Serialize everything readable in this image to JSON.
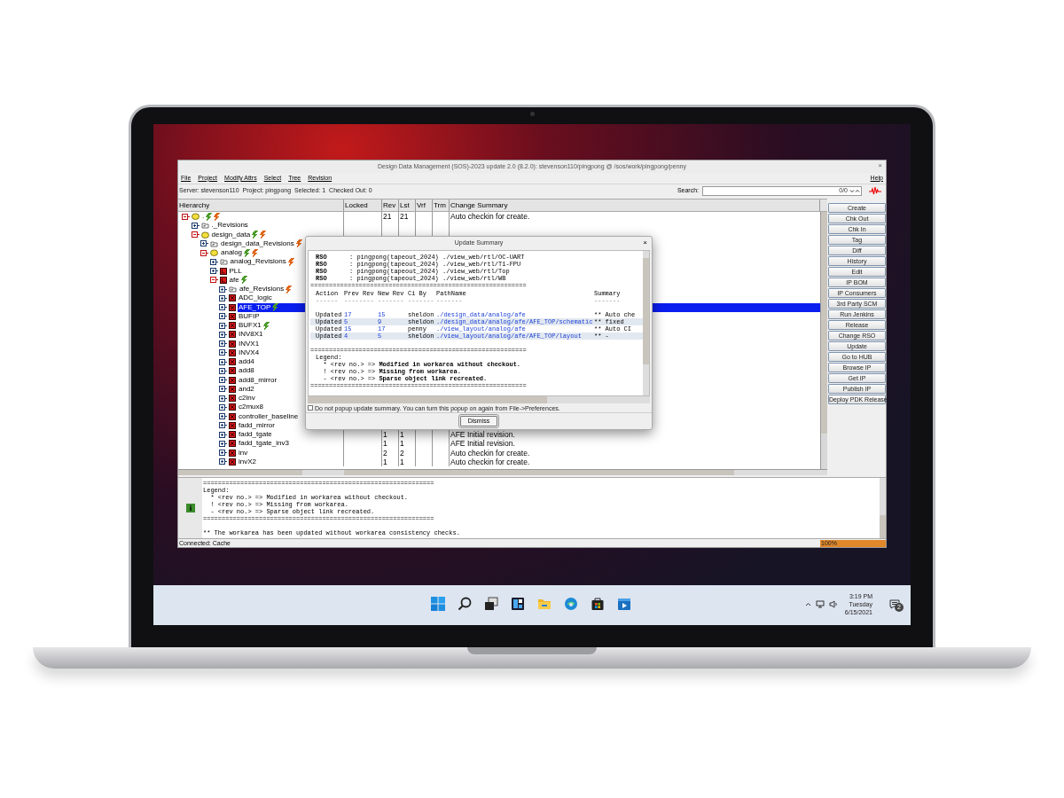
{
  "window": {
    "title": "Design Data Management (SOS)-2023 update 2.0 (8.2.0): stevenson110/pingpong @ /sos/work/pingpong/penny",
    "close": "×"
  },
  "menu": [
    "File",
    "Project",
    "Modify Attrs",
    "Select",
    "Tree",
    "Revision"
  ],
  "help_menu": "Help",
  "info_bar": [
    "Server: stevenson110",
    "Project: pingpong",
    "Selected: 1",
    "Checked Out: 0"
  ],
  "search": {
    "label": "Search:",
    "count": "0/0"
  },
  "main": {
    "columns": [
      "Hierarchy",
      "Locked",
      "Rev",
      "Lst",
      "Vrf",
      "Trm",
      "Change Summary"
    ],
    "tree": [
      {
        "name": ".",
        "kind": "folder",
        "expanded": true,
        "selected": false,
        "badges": [
          {
            "color": "#4a9a2a"
          },
          {
            "color": "#e0661a"
          }
        ],
        "rev": "21",
        "lst": "21",
        "summary": "Auto checkin for create.",
        "children": [
          {
            "name": "._Revisions",
            "kind": "revisions",
            "expanded": false,
            "selected": false
          },
          {
            "name": "design_data",
            "kind": "folder",
            "expanded": true,
            "selected": false,
            "badges": [
              {
                "color": "#4a9a2a"
              },
              {
                "color": "#e0661a"
              }
            ],
            "children": [
              {
                "name": "design_data_Revisions",
                "kind": "revisions",
                "expanded": false,
                "selected": false,
                "badges": [
                  {
                    "color": "#e0661a"
                  }
                ]
              },
              {
                "name": "analog",
                "kind": "folder",
                "expanded": true,
                "selected": false,
                "badges": [
                  {
                    "color": "#4a9a2a"
                  },
                  {
                    "color": "#e0661a"
                  }
                ],
                "children": [
                  {
                    "name": "analog_Revisions",
                    "kind": "revisions",
                    "expanded": false,
                    "selected": false,
                    "badges": [
                      {
                        "color": "#e0661a"
                      }
                    ]
                  },
                  {
                    "name": "PLL",
                    "kind": "library",
                    "expanded": false,
                    "selected": false
                  },
                  {
                    "name": "afe",
                    "kind": "library",
                    "expanded": true,
                    "selected": false,
                    "badges": [
                      {
                        "color": "#4a9a2a"
                      }
                    ],
                    "children": [
                      {
                        "name": "afe_Revisions",
                        "kind": "revisions",
                        "expanded": false,
                        "selected": false,
                        "badges": [
                          {
                            "color": "#e0661a"
                          }
                        ]
                      },
                      {
                        "name": "ADC_logic",
                        "kind": "cell",
                        "expanded": false,
                        "selected": false
                      },
                      {
                        "name": "AFE_TOP",
                        "kind": "cell",
                        "expanded": false,
                        "selected": true,
                        "badges": [
                          {
                            "color": "#4a9a2a"
                          }
                        ]
                      },
                      {
                        "name": "BUFIP",
                        "kind": "cell",
                        "expanded": false,
                        "selected": false
                      },
                      {
                        "name": "BUFX1",
                        "kind": "cell",
                        "expanded": false,
                        "selected": false,
                        "badges": [
                          {
                            "color": "#4a9a2a"
                          }
                        ]
                      },
                      {
                        "name": "INV8X1",
                        "kind": "cell",
                        "expanded": false,
                        "selected": false
                      },
                      {
                        "name": "INVX1",
                        "kind": "cell",
                        "expanded": false,
                        "selected": false
                      },
                      {
                        "name": "INVX4",
                        "kind": "cell",
                        "expanded": false,
                        "selected": false
                      },
                      {
                        "name": "add4",
                        "kind": "cell",
                        "expanded": false,
                        "selected": false
                      },
                      {
                        "name": "add8",
                        "kind": "cell",
                        "expanded": false,
                        "selected": false
                      },
                      {
                        "name": "add8_mirror",
                        "kind": "cell",
                        "expanded": false,
                        "selected": false
                      },
                      {
                        "name": "and2",
                        "kind": "cell",
                        "expanded": false,
                        "selected": false
                      },
                      {
                        "name": "c2inv",
                        "kind": "cell",
                        "expanded": false,
                        "selected": false
                      },
                      {
                        "name": "c2mux8",
                        "kind": "cell",
                        "expanded": false,
                        "selected": false
                      },
                      {
                        "name": "controller_baseline",
                        "kind": "cell",
                        "expanded": false,
                        "selected": false
                      },
                      {
                        "name": "fadd_mirror",
                        "kind": "cell",
                        "expanded": false,
                        "selected": false
                      },
                      {
                        "name": "fadd_tgate",
                        "kind": "cell",
                        "expanded": false,
                        "selected": false,
                        "rev": "1",
                        "lst": "1",
                        "summary": "AFE Initial revision."
                      },
                      {
                        "name": "fadd_tgate_inv3",
                        "kind": "cell",
                        "expanded": false,
                        "selected": false,
                        "rev": "1",
                        "lst": "1",
                        "summary": "AFE Initial revision."
                      },
                      {
                        "name": "inv",
                        "kind": "cell",
                        "expanded": false,
                        "selected": false,
                        "rev": "2",
                        "lst": "2",
                        "summary": "Auto checkin for create."
                      },
                      {
                        "name": "invX2",
                        "kind": "cell",
                        "expanded": false,
                        "selected": false,
                        "rev": "1",
                        "lst": "1",
                        "summary": "Auto checkin for create."
                      }
                    ]
                  }
                ]
              }
            ]
          }
        ]
      }
    ]
  },
  "actions": [
    "Create",
    "Chk Out",
    "Chk In",
    "Tag",
    "Diff",
    "History",
    "Edit",
    "IP BOM",
    "IP Consumers",
    "3rd Party SCM",
    "Run Jenkins",
    "Release",
    "Change RSO",
    "Update",
    "Go to HUB",
    "Browse IP",
    "Get IP",
    "Publish IP",
    "Deploy PDK Release"
  ],
  "log": {
    "rule": "==============================================================",
    "lines": [
      "Legend:",
      "  * <rev no.> => Modified in workarea without checkout.",
      "  ! <rev no.> => Missing from workarea.",
      "  - <rev no.> => Sparse object link recreated."
    ],
    "closing_rule": "==============================================================",
    "message": "** The workarea has been updated without workarea consistency checks."
  },
  "status_bar": {
    "connection": "Connected: Cache",
    "progress": {
      "level": 1,
      "label": "100%"
    }
  },
  "update_summary": {
    "title": "Update Summary",
    "close": "×",
    "rso_lines": [
      {
        "tag": "RSO",
        "text": ": pingpong(tapeout_2024) ./view_web/rtl/OC-UART"
      },
      {
        "tag": "RSO",
        "text": ": pingpong(tapeout_2024) ./view_web/rtl/T1-FPU"
      },
      {
        "tag": "RSO",
        "text": ": pingpong(tapeout_2024) ./view_web/rtl/Top"
      },
      {
        "tag": "RSO",
        "text": ": pingpong(tapeout_2024) ./view_web/rtl/WB"
      }
    ],
    "rule": "==========================================================",
    "columns": [
      "Action",
      "Prev Rev",
      "New Rev",
      "Ci By",
      "PathName",
      "Summary"
    ],
    "underlines": [
      "------",
      "--------",
      "-------",
      "-------",
      "-------",
      "-------"
    ],
    "rows": [
      {
        "action": "Updated",
        "prev_rev": "17",
        "new_rev": "15",
        "ci_by": "sheldon",
        "path": "./design_data/analog/afe",
        "summary": "** Auto che"
      },
      {
        "action": "Updated",
        "prev_rev": "5",
        "new_rev": "9",
        "ci_by": "sheldon",
        "path": "./design_data/analog/afe/AFE_TOP/schematic",
        "summary": "** fixed"
      },
      {
        "action": "Updated",
        "prev_rev": "15",
        "new_rev": "17",
        "ci_by": "penny",
        "path": "./view_layout/analog/afe",
        "summary": "** Auto CI"
      },
      {
        "action": "Updated",
        "prev_rev": "4",
        "new_rev": "5",
        "ci_by": "sheldon",
        "path": "./view_layout/analog/afe/AFE_TOP/layout",
        "summary": "** -"
      }
    ],
    "rule_2": "==========================================================",
    "legend_title": "Legend:",
    "legend": [
      "  * <rev no.> => **Modified in workarea without checkout.**",
      "  ! <rev no.> => **Missing from workarea.**",
      "  - <rev no.> => **Sparse object link recreated.**"
    ],
    "rule_3": "==========================================================",
    "checkbox": {
      "label": "Do not popup update summary. You can turn this popup on again from File->Preferences.",
      "checked": false
    },
    "dismiss": "Dismiss"
  },
  "taskbar": {
    "clock": {
      "time": "3:19 PM",
      "day": "Tuesday",
      "date": "6/15/2021"
    },
    "notification_count": "2"
  }
}
